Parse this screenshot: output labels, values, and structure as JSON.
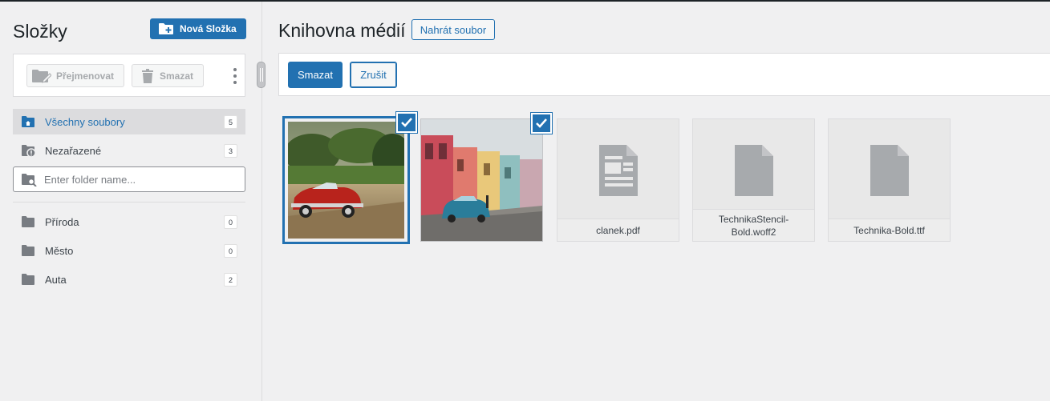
{
  "sidebar": {
    "title": "Složky",
    "new_folder_label": "Nová Složka",
    "toolbar": {
      "rename_label": "Přejmenovat",
      "delete_label": "Smazat"
    },
    "folders": [
      {
        "label": "Všechny soubory",
        "count": "5",
        "icon": "home-folder-icon",
        "active": true
      },
      {
        "label": "Nezařazené",
        "count": "3",
        "icon": "uncategorized-folder-icon",
        "active": false
      }
    ],
    "search": {
      "placeholder": "Enter folder name..."
    },
    "user_folders": [
      {
        "label": "Příroda",
        "count": "0",
        "icon": "folder-icon"
      },
      {
        "label": "Město",
        "count": "0",
        "icon": "folder-icon"
      },
      {
        "label": "Auta",
        "count": "2",
        "icon": "folder-icon"
      }
    ]
  },
  "main": {
    "title": "Knihovna médií",
    "upload_label": "Nahrát soubor",
    "actions": {
      "delete_label": "Smazat",
      "cancel_label": "Zrušit"
    },
    "items": [
      {
        "type": "image",
        "subject": "red vintage convertible car on road",
        "selected": true
      },
      {
        "type": "image",
        "subject": "blue vintage car on colorful street",
        "selected": true
      },
      {
        "type": "file",
        "name": "clanek.pdf",
        "icon": "document-icon",
        "selected": false
      },
      {
        "type": "file",
        "name": "TechnikaStencil-Bold.woff2",
        "icon": "file-icon",
        "selected": false
      },
      {
        "type": "file",
        "name": "Technika-Bold.ttf",
        "icon": "file-icon",
        "selected": false
      }
    ]
  },
  "colors": {
    "accent": "#2271b1",
    "background": "#f0f0f1",
    "border": "#dcdcde"
  }
}
